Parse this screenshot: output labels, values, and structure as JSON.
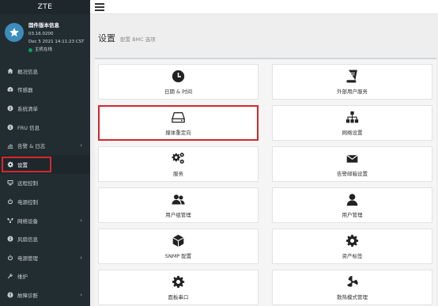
{
  "brand": {
    "title": "ZTE"
  },
  "user": {
    "title": "固件版本信息",
    "version": "03.16.0200",
    "date": "Dec 5 2021 14:11:23 CST",
    "status": "主机在线"
  },
  "sidebar": {
    "items": [
      {
        "label": "概况信息",
        "icon": "home-icon"
      },
      {
        "label": "传感器",
        "icon": "dashboard-icon"
      },
      {
        "label": "系统清单",
        "icon": "info-icon"
      },
      {
        "label": "FRU 信息",
        "icon": "info-icon"
      },
      {
        "label": "告警 & 日志",
        "icon": "bar-chart-icon"
      },
      {
        "label": "设置",
        "icon": "gear-icon"
      },
      {
        "label": "远程控制",
        "icon": "monitor-icon"
      },
      {
        "label": "电源控制",
        "icon": "power-icon"
      },
      {
        "label": "网络设备",
        "icon": "network-icon"
      },
      {
        "label": "风扇信息",
        "icon": "info-icon"
      },
      {
        "label": "电源管理",
        "icon": "power-plug-icon"
      },
      {
        "label": "维护",
        "icon": "wrench-icon"
      },
      {
        "label": "故障诊断",
        "icon": "diagnose-icon"
      }
    ]
  },
  "header": {
    "title": "设置",
    "subtitle": "配置 BMC 选项"
  },
  "cards": [
    {
      "label": "日期 & 时间",
      "icon": "clock-icon"
    },
    {
      "label": "外部用户服务",
      "icon": "book-icon"
    },
    {
      "label": "媒体重定向",
      "icon": "drive-icon"
    },
    {
      "label": "网络设置",
      "icon": "sitemap-icon"
    },
    {
      "label": "服务",
      "icon": "gears-icon"
    },
    {
      "label": "告警邮箱设置",
      "icon": "envelope-icon"
    },
    {
      "label": "用户组管理",
      "icon": "users-icon"
    },
    {
      "label": "用户管理",
      "icon": "user-icon"
    },
    {
      "label": "SNMP 配置",
      "icon": "cube-icon"
    },
    {
      "label": "资产标签",
      "icon": "gear-icon"
    },
    {
      "label": "面板串口",
      "icon": "gear-icon"
    },
    {
      "label": "散热模式管理",
      "icon": "radiation-icon"
    }
  ],
  "colors": {
    "sidebar": "#222d32",
    "accent": "#3c8dbc",
    "highlight": "#d7262b",
    "online": "#00a65a"
  }
}
